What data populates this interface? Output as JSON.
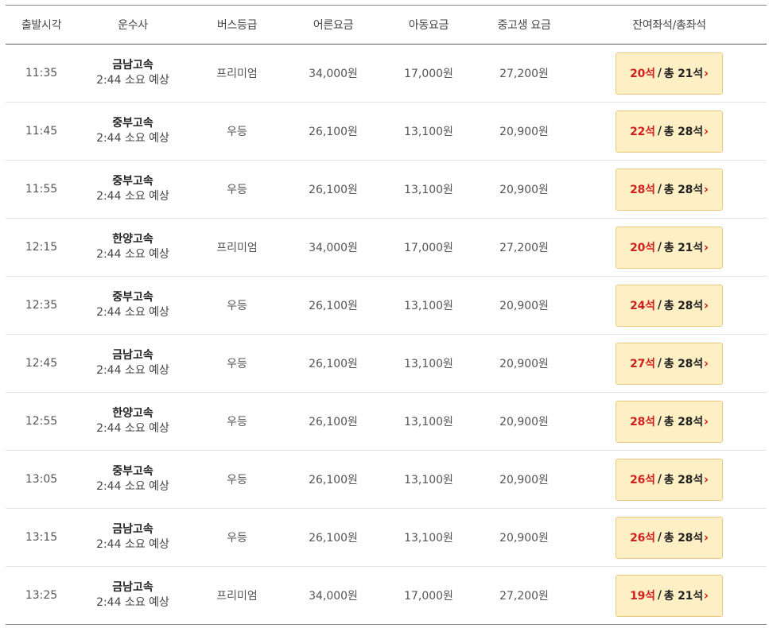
{
  "headers": {
    "departure_time": "출발시각",
    "company": "운수사",
    "bus_grade": "버스등급",
    "adult_fare": "어른요금",
    "child_fare": "아동요금",
    "student_fare": "중고생 요금",
    "seats": "잔여좌석/총좌석"
  },
  "seat_separator": "/",
  "seat_arrow": "›",
  "colors": {
    "remaining_seats": "#d0201e",
    "seat_button_bg": "#fef0c4",
    "seat_button_border": "#e9c77c"
  },
  "rows": [
    {
      "time": "11:35",
      "company": "금남고속",
      "duration": "2:44 소요 예상",
      "grade": "프리미엄",
      "adult": "34,000원",
      "child": "17,000원",
      "student": "27,200원",
      "remaining": "20석",
      "total": "총 21석"
    },
    {
      "time": "11:45",
      "company": "중부고속",
      "duration": "2:44 소요 예상",
      "grade": "우등",
      "adult": "26,100원",
      "child": "13,100원",
      "student": "20,900원",
      "remaining": "22석",
      "total": "총 28석"
    },
    {
      "time": "11:55",
      "company": "중부고속",
      "duration": "2:44 소요 예상",
      "grade": "우등",
      "adult": "26,100원",
      "child": "13,100원",
      "student": "20,900원",
      "remaining": "28석",
      "total": "총 28석"
    },
    {
      "time": "12:15",
      "company": "한양고속",
      "duration": "2:44 소요 예상",
      "grade": "프리미엄",
      "adult": "34,000원",
      "child": "17,000원",
      "student": "27,200원",
      "remaining": "20석",
      "total": "총 21석"
    },
    {
      "time": "12:35",
      "company": "중부고속",
      "duration": "2:44 소요 예상",
      "grade": "우등",
      "adult": "26,100원",
      "child": "13,100원",
      "student": "20,900원",
      "remaining": "24석",
      "total": "총 28석"
    },
    {
      "time": "12:45",
      "company": "금남고속",
      "duration": "2:44 소요 예상",
      "grade": "우등",
      "adult": "26,100원",
      "child": "13,100원",
      "student": "20,900원",
      "remaining": "27석",
      "total": "총 28석"
    },
    {
      "time": "12:55",
      "company": "한양고속",
      "duration": "2:44 소요 예상",
      "grade": "우등",
      "adult": "26,100원",
      "child": "13,100원",
      "student": "20,900원",
      "remaining": "28석",
      "total": "총 28석"
    },
    {
      "time": "13:05",
      "company": "중부고속",
      "duration": "2:44 소요 예상",
      "grade": "우등",
      "adult": "26,100원",
      "child": "13,100원",
      "student": "20,900원",
      "remaining": "26석",
      "total": "총 28석"
    },
    {
      "time": "13:15",
      "company": "금남고속",
      "duration": "2:44 소요 예상",
      "grade": "우등",
      "adult": "26,100원",
      "child": "13,100원",
      "student": "20,900원",
      "remaining": "26석",
      "total": "총 28석"
    },
    {
      "time": "13:25",
      "company": "금남고속",
      "duration": "2:44 소요 예상",
      "grade": "프리미엄",
      "adult": "34,000원",
      "child": "17,000원",
      "student": "27,200원",
      "remaining": "19석",
      "total": "총 21석"
    }
  ]
}
